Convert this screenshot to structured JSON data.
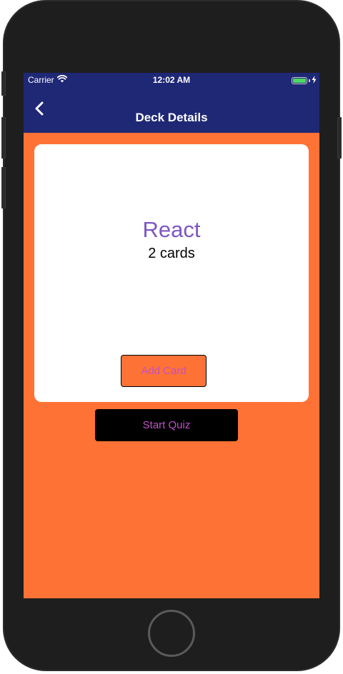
{
  "status_bar": {
    "carrier": "Carrier",
    "time": "12:02 AM",
    "battery_level": 1.0,
    "battery_color": "#4cd964"
  },
  "nav_bar": {
    "title": "Deck Details",
    "back_icon": "chevron-left-icon",
    "background": "#1f2875"
  },
  "deck": {
    "title": "React",
    "count": "2 cards",
    "title_color": "#7e57c2"
  },
  "actions": {
    "add_card_label": "Add Card",
    "start_quiz_label": "Start Quiz",
    "label_color": "#c050c8"
  },
  "theme": {
    "screen_background": "#ff7236"
  }
}
